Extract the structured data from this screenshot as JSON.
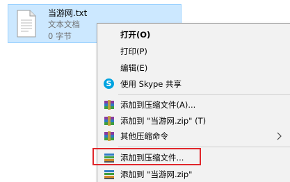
{
  "file": {
    "name": "当游网.txt",
    "type": "文本文档",
    "size": "0 字节"
  },
  "menu": {
    "items": [
      {
        "label": "打开(O)",
        "bold": true
      },
      {
        "label": "打印(P)"
      },
      {
        "label": "编辑(E)"
      },
      {
        "label": "使用 Skype 共享",
        "icon": "skype-icon"
      },
      {
        "label": "添加到压缩文件(A)...",
        "icon": "winrar-icon"
      },
      {
        "label": "添加到 \"当游网.zip\" (T)",
        "icon": "winrar-icon"
      },
      {
        "label": "其他压缩命令",
        "icon": "winrar-icon",
        "submenu_arrow": "chevron-right-icon"
      },
      {
        "label": "添加到压缩文件...",
        "icon": "archive-stack-icon",
        "highlighted": true
      },
      {
        "label": "添加到 \"当游网.zip\"",
        "icon": "archive-stack-icon"
      }
    ]
  },
  "colors": {
    "selection_bg": "#cce8ff",
    "selection_border": "#99d1ff",
    "menu_bg": "#f2f2f2",
    "highlight_border": "#e0262b",
    "skype_blue": "#00a3e0"
  }
}
